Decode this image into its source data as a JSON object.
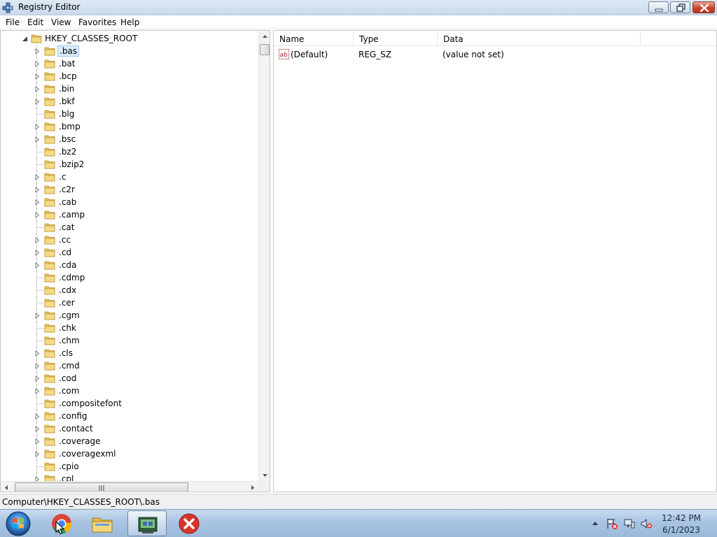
{
  "window": {
    "title": "Registry Editor"
  },
  "menu": [
    "File",
    "Edit",
    "View",
    "Favorites",
    "Help"
  ],
  "tree": {
    "root": "HKEY_CLASSES_ROOT",
    "items": [
      {
        "label": ".bas",
        "expandable": true,
        "selected": true
      },
      {
        "label": ".bat",
        "expandable": true
      },
      {
        "label": ".bcp",
        "expandable": true
      },
      {
        "label": ".bin",
        "expandable": true
      },
      {
        "label": ".bkf",
        "expandable": true
      },
      {
        "label": ".blg",
        "expandable": false
      },
      {
        "label": ".bmp",
        "expandable": true
      },
      {
        "label": ".bsc",
        "expandable": true
      },
      {
        "label": ".bz2",
        "expandable": false
      },
      {
        "label": ".bzip2",
        "expandable": false
      },
      {
        "label": ".c",
        "expandable": true
      },
      {
        "label": ".c2r",
        "expandable": true
      },
      {
        "label": ".cab",
        "expandable": true
      },
      {
        "label": ".camp",
        "expandable": true
      },
      {
        "label": ".cat",
        "expandable": false
      },
      {
        "label": ".cc",
        "expandable": true
      },
      {
        "label": ".cd",
        "expandable": true
      },
      {
        "label": ".cda",
        "expandable": true
      },
      {
        "label": ".cdmp",
        "expandable": false
      },
      {
        "label": ".cdx",
        "expandable": false
      },
      {
        "label": ".cer",
        "expandable": false
      },
      {
        "label": ".cgm",
        "expandable": true
      },
      {
        "label": ".chk",
        "expandable": false
      },
      {
        "label": ".chm",
        "expandable": false
      },
      {
        "label": ".cls",
        "expandable": true
      },
      {
        "label": ".cmd",
        "expandable": true
      },
      {
        "label": ".cod",
        "expandable": true
      },
      {
        "label": ".com",
        "expandable": true
      },
      {
        "label": ".compositefont",
        "expandable": false
      },
      {
        "label": ".config",
        "expandable": true
      },
      {
        "label": ".contact",
        "expandable": true
      },
      {
        "label": ".coverage",
        "expandable": true
      },
      {
        "label": ".coveragexml",
        "expandable": true
      },
      {
        "label": ".cpio",
        "expandable": false
      },
      {
        "label": ".cpl",
        "expandable": true
      }
    ]
  },
  "values": {
    "columns": {
      "name": "Name",
      "type": "Type",
      "data": "Data"
    },
    "rows": [
      {
        "name": "(Default)",
        "type": "REG_SZ",
        "data": "(value not set)",
        "icon": "string-value-icon"
      }
    ]
  },
  "status": {
    "path": "Computer\\HKEY_CLASSES_ROOT\\.bas"
  },
  "taskbar": {
    "apps": [
      {
        "name": "chrome-icon"
      },
      {
        "name": "file-explorer-icon"
      },
      {
        "name": "registry-editor-icon",
        "active": true
      },
      {
        "name": "error-app-icon"
      }
    ],
    "time": "12:42 PM",
    "date": "6/1/2023"
  },
  "colors": {
    "selection_bg": "#dcebfb",
    "selection_border": "#9ec6ef",
    "close_button": "#c7442c",
    "taskbar": "#a9c4e2"
  }
}
